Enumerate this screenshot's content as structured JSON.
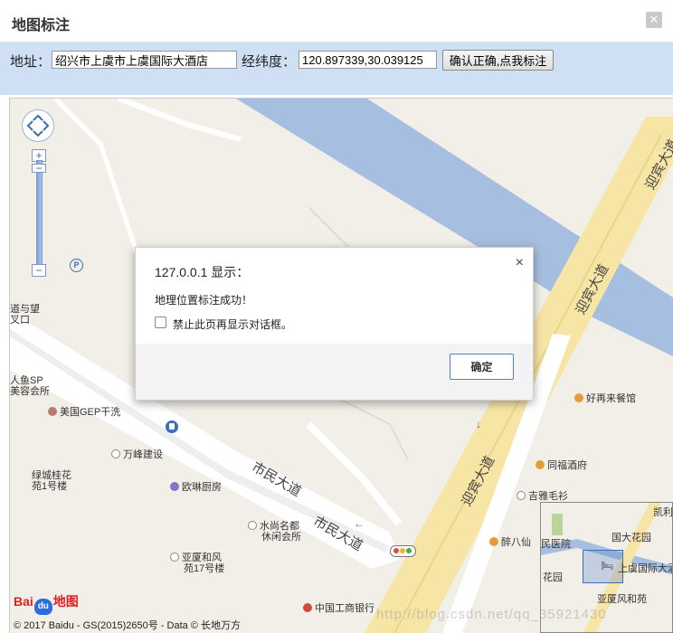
{
  "dialog": {
    "title": "地图标注",
    "close_glyph": "✕"
  },
  "toolbar": {
    "address_label": "地址：",
    "address_value": "绍兴市上虞市上虞国际大酒店",
    "coords_label": "经纬度：",
    "coords_value": "120.897339,30.039125",
    "confirm_button": "确认正确,点我标注"
  },
  "map": {
    "controls": {
      "zoom_in": "+",
      "zoom_out": "−"
    },
    "road_labels": [
      "迎宾大道",
      "迎宾大道",
      "迎宾大道",
      "市民大道",
      "市民大道"
    ],
    "arrows": [
      "←",
      "↓"
    ],
    "pois": [
      {
        "name": "道与望",
        "icon": "none"
      },
      {
        "name": "叉口",
        "icon": "none"
      },
      {
        "name": "人鱼SP",
        "icon": "none"
      },
      {
        "name": "美容会所",
        "icon": "none"
      },
      {
        "name": "美国GEP干洗",
        "icon": "laundry-icon"
      },
      {
        "name": "万峰建设",
        "icon": "dot-icon"
      },
      {
        "name": "绿城桂花",
        "icon": "none"
      },
      {
        "name": "苑1号楼",
        "icon": "none"
      },
      {
        "name": "欧琳厨房",
        "icon": "shopping-icon"
      },
      {
        "name": "水尚名都",
        "icon": "dot-icon"
      },
      {
        "name": "休闲会所",
        "icon": "none"
      },
      {
        "name": "亚厦和风",
        "icon": "dot-icon"
      },
      {
        "name": "苑17号楼",
        "icon": "none"
      },
      {
        "name": "中国工商银行",
        "icon": "bank-icon"
      },
      {
        "name": "好再来餐馆",
        "icon": "food-icon"
      },
      {
        "name": "同福酒府",
        "icon": "food-icon"
      },
      {
        "name": "吉雅毛衫",
        "icon": "dot-icon"
      },
      {
        "name": "醉八仙",
        "icon": "food-icon"
      }
    ],
    "overview": {
      "labels": [
        "凯利",
        "国大花园",
        "民医院",
        "上虞国际大酒",
        "花园",
        "亚厦风和苑"
      ]
    },
    "logo": {
      "text_before": "Bai",
      "text_paw": "du",
      "text_after": "地图"
    },
    "copyright": "© 2017 Baidu - GS(2015)2650号 - Data © 长地万方",
    "watermark": "http://blog.csdn.net/qq_35921430"
  },
  "alert": {
    "title": "127.0.0.1 显示：",
    "close_glyph": "×",
    "message": "地理位置标注成功！",
    "checkbox_label": "禁止此页再显示对话框。",
    "checked": false,
    "ok_button": "确定"
  },
  "colors": {
    "toolbar_bg": "#cfe0f5",
    "map_bg": "#f2efe9",
    "river": "#a6bedf",
    "main_road": "#f7e5a6",
    "alert_ok_border": "#4d7fd0"
  }
}
